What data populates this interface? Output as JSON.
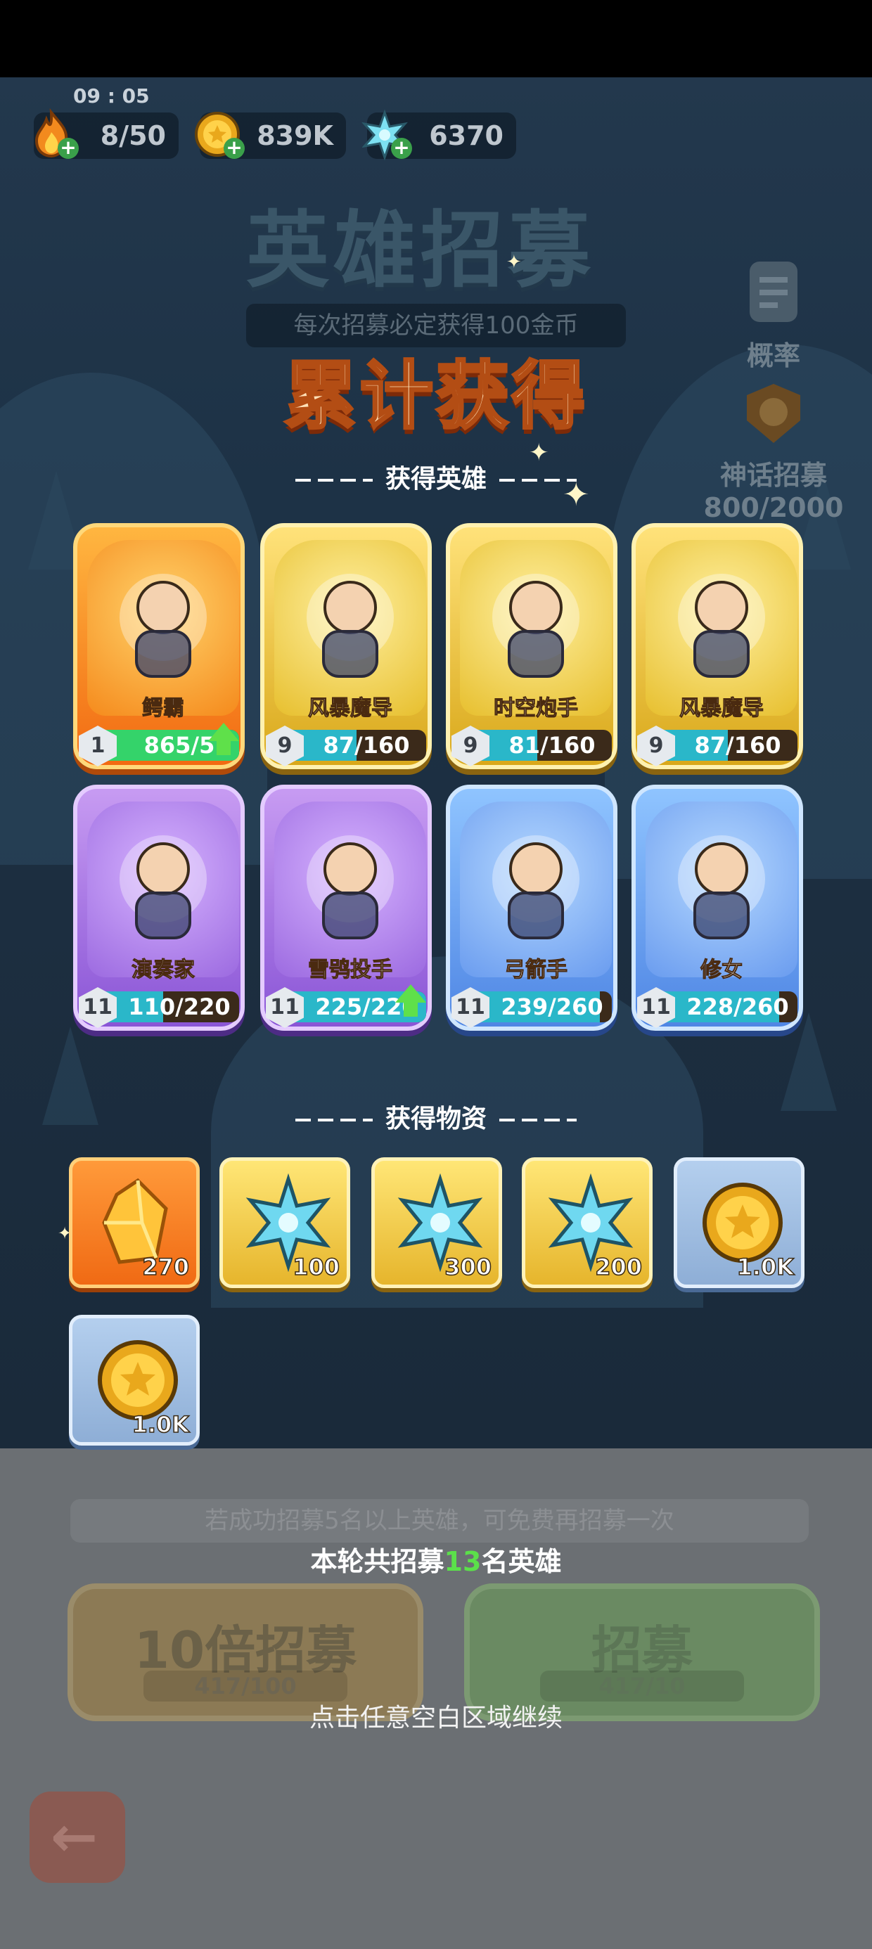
{
  "status": {
    "time": "09 : 05"
  },
  "resources": [
    {
      "name": "energy",
      "icon": "fire-icon",
      "value": "8/50"
    },
    {
      "name": "gold",
      "icon": "gold-coin-icon",
      "value": "839K"
    },
    {
      "name": "crystal",
      "icon": "ice-crystal-icon",
      "value": "6370"
    }
  ],
  "background": {
    "title": "英雄招募",
    "subtitle": "每次招募必定获得100金币",
    "probability_label": "概率",
    "myth_label": "神话招募",
    "myth_progress": "800/2000"
  },
  "dialog": {
    "title": "累计获得",
    "heroes_section": "获得英雄",
    "items_section": "获得物资"
  },
  "heroes": [
    {
      "name": "鳄霸",
      "level": "1",
      "progress": "865/5",
      "fill": 1.0,
      "rarity": "orange",
      "upgrade": true
    },
    {
      "name": "风暴魔导",
      "level": "9",
      "progress": "87/160",
      "fill": 0.54,
      "rarity": "gold",
      "upgrade": false
    },
    {
      "name": "时空炮手",
      "level": "9",
      "progress": "81/160",
      "fill": 0.51,
      "rarity": "gold",
      "upgrade": false
    },
    {
      "name": "风暴魔导",
      "level": "9",
      "progress": "87/160",
      "fill": 0.54,
      "rarity": "gold",
      "upgrade": false
    },
    {
      "name": "演奏家",
      "level": "11",
      "progress": "110/220",
      "fill": 0.5,
      "rarity": "purple",
      "upgrade": false
    },
    {
      "name": "雪鸮投手",
      "level": "11",
      "progress": "225/220",
      "fill": 1.0,
      "rarity": "purple",
      "upgrade": true
    },
    {
      "name": "弓箭手",
      "level": "11",
      "progress": "239/260",
      "fill": 0.92,
      "rarity": "blue",
      "upgrade": false
    },
    {
      "name": "修女",
      "level": "11",
      "progress": "228/260",
      "fill": 0.88,
      "rarity": "blue",
      "upgrade": false
    }
  ],
  "items": [
    {
      "icon": "amber-crystal-icon",
      "qty": "270",
      "rarity": "orange"
    },
    {
      "icon": "ice-crystal-icon",
      "qty": "100",
      "rarity": "gold"
    },
    {
      "icon": "ice-crystal-icon",
      "qty": "300",
      "rarity": "gold"
    },
    {
      "icon": "ice-crystal-icon",
      "qty": "200",
      "rarity": "gold"
    },
    {
      "icon": "gold-coin-icon",
      "qty": "1.0K",
      "rarity": "blue"
    },
    {
      "icon": "gold-coin-icon",
      "qty": "1.0K",
      "rarity": "blue"
    }
  ],
  "bottom": {
    "hint": "若成功招募5名以上英雄，可免费再招募一次",
    "round_prefix": "本轮共招募",
    "round_count": "13",
    "round_suffix": "名英雄",
    "ten_label": "10倍招募",
    "ten_cost": "417/100",
    "one_label": "招募",
    "one_cost": "417/10",
    "continue": "点击任意空白区域继续"
  },
  "colors": {
    "orange_fill": "#34d36a",
    "gold_fill": "#2ab7c9",
    "blue_fill": "#2ab7c9",
    "purple_fill": "#2ab7c9",
    "title_stroke": "#b34d14",
    "green_text": "#5be04a"
  }
}
